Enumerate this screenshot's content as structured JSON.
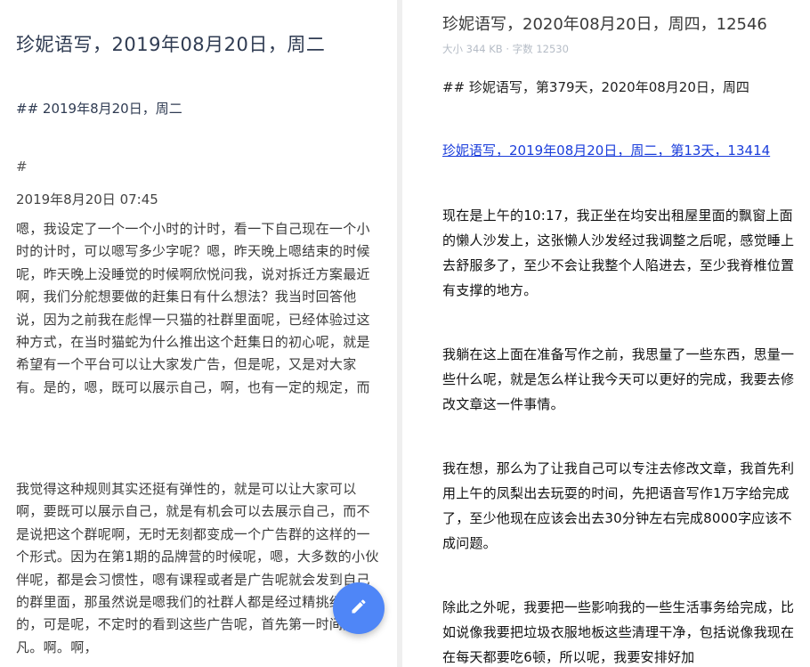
{
  "left": {
    "title": "珍妮语写，2019年08月20日，周二",
    "heading": "## 2019年8月20日，周二",
    "hash": "#",
    "timestamp": "2019年8月20日 07:45",
    "paragraph1": "嗯，我设定了一个一个小时的计时，看一下自己现在一个小时的计时，可以嗯写多少字呢？嗯，昨天晚上嗯结束的时候呢，昨天晚上没睡觉的时候啊欣悦问我，说对拆迁方案最近啊，我们分舵想要做的赶集日有什么想法？我当时回答他说，因为之前我在彪悍一只猫的社群里面呢，已经体验过这种方式，在当时猫蛇为什么推出这个赶集日的初心呢，就是希望有一个平台可以让大家发广告，但是呢，又是对大家有。是的，嗯，既可以展示自己，啊，也有一定的规定，而",
    "paragraph2": "我觉得这种规则其实还挺有弹性的，就是可以让大家可以啊，要既可以展示自己，就是有机会可以去展示自己，而不是说把这个群呢啊，无时无刻都变成一个广告群的这样的一个形式。因为在第1期的品牌营的时候呢，嗯，大多数的小伙伴呢，都是会习惯性，嗯有课程或者是广告呢就会发到自己的群里面，那虽然说是嗯我们的社群人都是经过精挑细选的，可是呢，不定时的看到这些广告呢，首先第一时间是凡。啊。啊，",
    "fab_icon": "pencil-icon"
  },
  "right": {
    "title": "珍妮语写，2020年08月20日，周四，12546",
    "meta": "大小 344 KB  ·  字数 12530",
    "heading": "## 珍妮语写，第379天，2020年08月20日，周四",
    "link": "珍妮语写，2019年08月20日，周二，第13天，13414",
    "paragraphs": [
      "现在是上午的10:17，我正坐在均安出租屋里面的飘窗上面的懒人沙发上，这张懒人沙发经过我调整之后呢，感觉睡上去舒服多了，至少不会让我整个人陷进去，至少我脊椎位置有支撑的地方。",
      "我躺在这上面在准备写作之前，我思量了一些东西，思量一些什么呢，就是怎么样让我今天可以更好的完成，我要去修改文章这一件事情。",
      "我在想，那么为了让我自己可以专注去修改文章，我首先利用上午的凤梨出去玩耍的时间，先把语音写作1万字给完成了，至少他现在应该会出去30分钟左右完成8000字应该不成问题。",
      "除此之外呢，我要把一些影响我的一些生活事务给完成，比如说像我要把垃圾衣服地板这些清理干净，包括说像我现在在每天都要吃6顿，所以呢，我要安排好加"
    ]
  },
  "colors": {
    "fab": "#4f86f7",
    "link": "#1a3ddb",
    "title_left": "#2f3b52",
    "meta": "#b5bcc6"
  }
}
